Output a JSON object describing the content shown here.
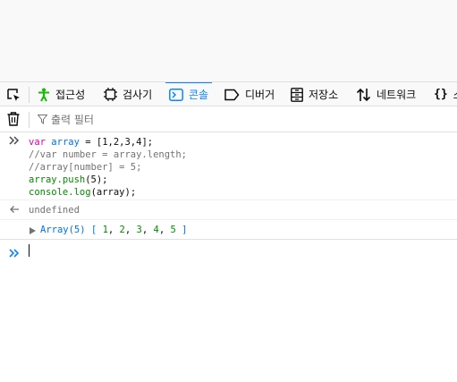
{
  "toolbar": {
    "tabs": [
      {
        "label": "접근성",
        "icon": "accessibility-icon"
      },
      {
        "label": "검사기",
        "icon": "inspector-icon"
      },
      {
        "label": "콘솔",
        "icon": "console-icon",
        "selected": true
      },
      {
        "label": "디버거",
        "icon": "debugger-icon"
      },
      {
        "label": "저장소",
        "icon": "storage-icon"
      },
      {
        "label": "네트워크",
        "icon": "network-icon"
      },
      {
        "label": "스",
        "icon": "style-editor-icon"
      }
    ]
  },
  "filter": {
    "placeholder": "출력 필터"
  },
  "console": {
    "input_lines": [
      {
        "keyword": "var",
        "name": "array",
        "rest": " = [1,2,3,4];"
      },
      {
        "text": "//var number = array.length;"
      },
      {
        "text": "//array[number] = 5;"
      },
      {
        "object": "array",
        "method": ".push",
        "rest": "(5);"
      },
      {
        "object": "console",
        "method": ".log",
        "rest": "(array);"
      }
    ],
    "result": "undefined",
    "log": {
      "name": "Array(5)",
      "open": "[",
      "items": [
        "1",
        "2",
        "3",
        "4",
        "5"
      ],
      "close": "]"
    }
  },
  "colors": {
    "accent": "#0a84ff",
    "keyword": "#dd00a9",
    "variable": "#0074e8",
    "number": "#058b00",
    "comment": "#737373"
  }
}
